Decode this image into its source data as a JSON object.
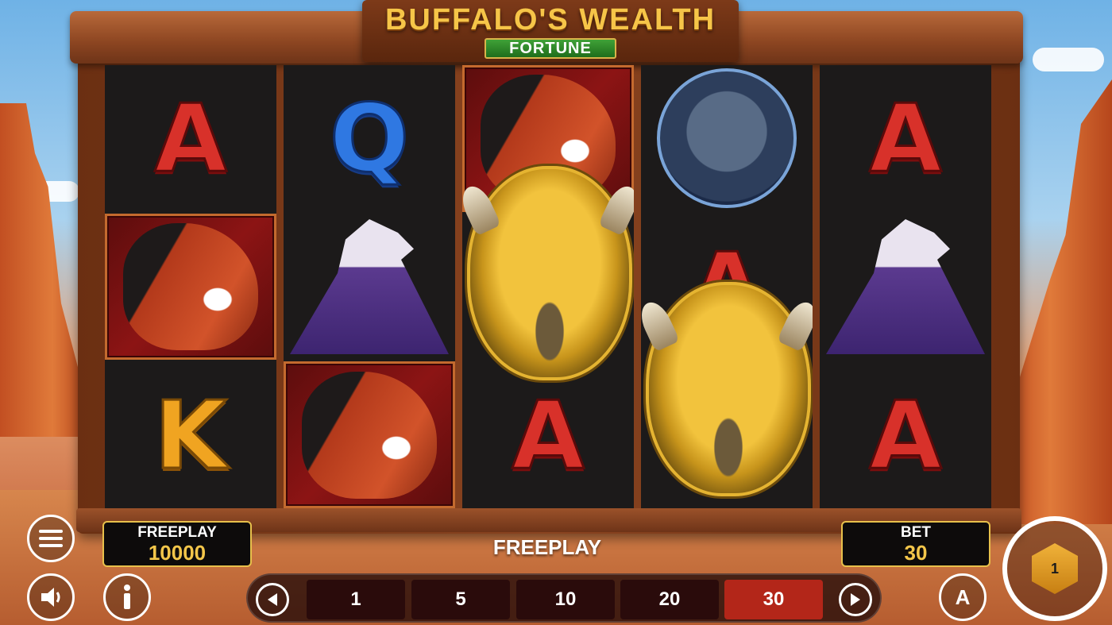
{
  "game": {
    "title": "BUFFALO'S WEALTH",
    "subtitle": "FORTUNE"
  },
  "reels": [
    [
      "A",
      "horse",
      "K"
    ],
    [
      "Q",
      "eagle",
      "horse"
    ],
    [
      "horse",
      "buffalo",
      "A"
    ],
    [
      "panther",
      "A",
      "buffalo"
    ],
    [
      "A",
      "eagle",
      "A"
    ]
  ],
  "balance": {
    "label": "FREEPLAY",
    "value": "10000"
  },
  "status": "FREEPLAY",
  "bet": {
    "label": "BET",
    "value": "30",
    "options": [
      "1",
      "5",
      "10",
      "20",
      "30"
    ],
    "selected": "30"
  },
  "spin": {
    "badge": "1"
  },
  "auto": {
    "label": "A"
  },
  "icons": [
    "menu-icon",
    "sound-icon",
    "info-icon",
    "arrow-left-icon",
    "arrow-right-icon",
    "autoplay-icon",
    "spin-icon"
  ],
  "colors": {
    "panel_border": "#e7c04b",
    "value_gold": "#f3c64a",
    "active_bet": "#b32619",
    "logo_green": "#3fa137"
  }
}
